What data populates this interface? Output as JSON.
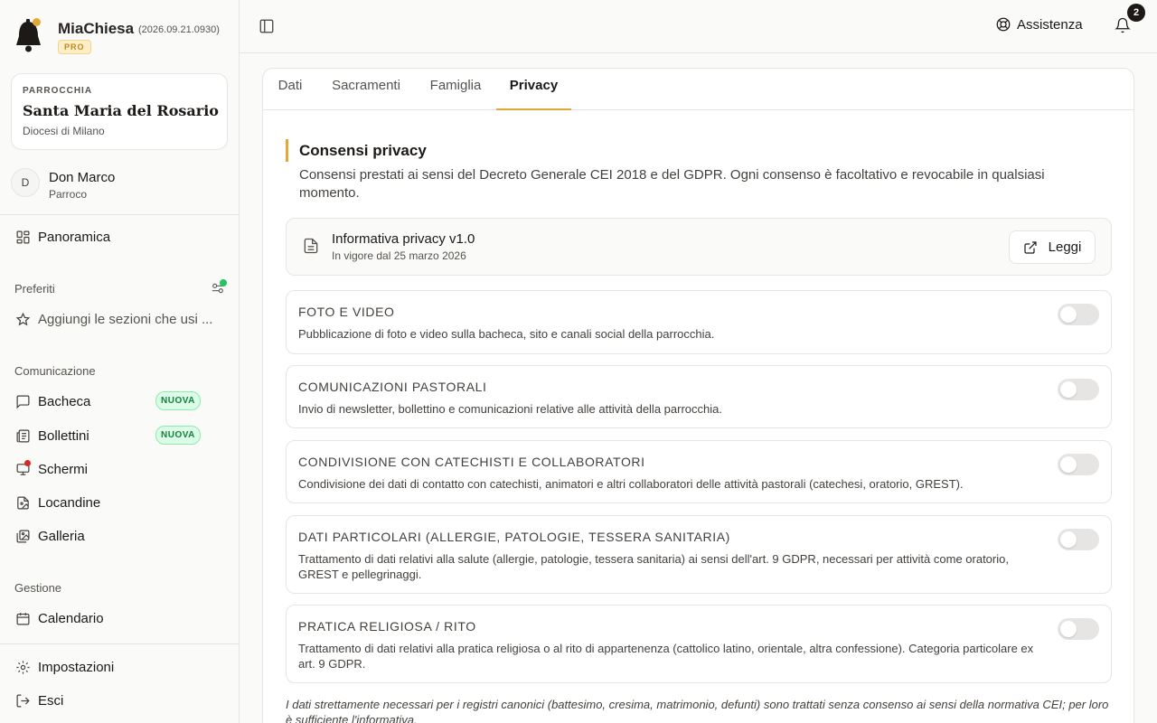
{
  "brand": {
    "name": "MiaChiesa",
    "version": "(2026.09.21.0930)",
    "tier": "PRO"
  },
  "parish": {
    "kicker": "PARROCCHIA",
    "name": "Santa Maria del Rosario",
    "diocese": "Diocesi di Milano"
  },
  "user": {
    "initial": "D",
    "name": "Don Marco",
    "role": "Parroco"
  },
  "sidebar": {
    "overview": "Panoramica",
    "favorites_label": "Preferiti",
    "favorites_hint": "Aggiungi le sezioni che usi ...",
    "communication_label": "Comunicazione",
    "communication": [
      {
        "label": "Bacheca",
        "badge": "NUOVA",
        "icon": "message-square-icon"
      },
      {
        "label": "Bollettini",
        "badge": "NUOVA",
        "icon": "newspaper-icon"
      },
      {
        "label": "Schermi",
        "badge": "",
        "icon": "monitor-icon"
      },
      {
        "label": "Locandine",
        "badge": "",
        "icon": "file-image-icon"
      },
      {
        "label": "Galleria",
        "badge": "",
        "icon": "gallery-icon"
      }
    ],
    "management_label": "Gestione",
    "calendar": "Calendario",
    "settings": "Impostazioni",
    "logout": "Esci"
  },
  "topbar": {
    "help": "Assistenza",
    "notifications_count": "2"
  },
  "tabs": [
    "Dati",
    "Sacramenti",
    "Famiglia",
    "Privacy"
  ],
  "active_tab": "Privacy",
  "privacy": {
    "title": "Consensi privacy",
    "description": "Consensi prestati ai sensi del Decreto Generale CEI 2018 e del GDPR. Ogni consenso è facoltativo e revocabile in qualsiasi momento.",
    "policy": {
      "title": "Informativa privacy v1.0",
      "date": "In vigore dal 25 marzo 2026",
      "read_label": "Leggi"
    },
    "consents": [
      {
        "title": "FOTO E VIDEO",
        "desc": "Pubblicazione di foto e video sulla bacheca, sito e canali social della parrocchia.",
        "enabled": false
      },
      {
        "title": "COMUNICAZIONI PASTORALI",
        "desc": "Invio di newsletter, bollettino e comunicazioni relative alle attività della parrocchia.",
        "enabled": false
      },
      {
        "title": "CONDIVISIONE CON CATECHISTI E COLLABORATORI",
        "desc": "Condivisione dei dati di contatto con catechisti, animatori e altri collaboratori delle attività pastorali (catechesi, oratorio, GREST).",
        "enabled": false
      },
      {
        "title": "DATI PARTICOLARI (ALLERGIE, PATOLOGIE, TESSERA SANITARIA)",
        "desc": "Trattamento di dati relativi alla salute (allergie, patologie, tessera sanitaria) ai sensi dell'art. 9 GDPR, necessari per attività come oratorio, GREST e pellegrinaggi.",
        "enabled": false
      },
      {
        "title": "PRATICA RELIGIOSA / RITO",
        "desc": "Trattamento di dati relativi alla pratica religiosa o al rito di appartenenza (cattolico latino, orientale, altra confessione). Categoria particolare ex art. 9 GDPR.",
        "enabled": false
      }
    ],
    "footnote": "I dati strettamente necessari per i registri canonici (battesimo, cresima, matrimonio, defunti) sono trattati senza consenso ai sensi della normativa CEI; per loro è sufficiente l'informativa."
  },
  "colors": {
    "accent": "#e0a83b",
    "new_badge": "#15803d",
    "alert": "#dc2626",
    "online": "#22c55e"
  }
}
